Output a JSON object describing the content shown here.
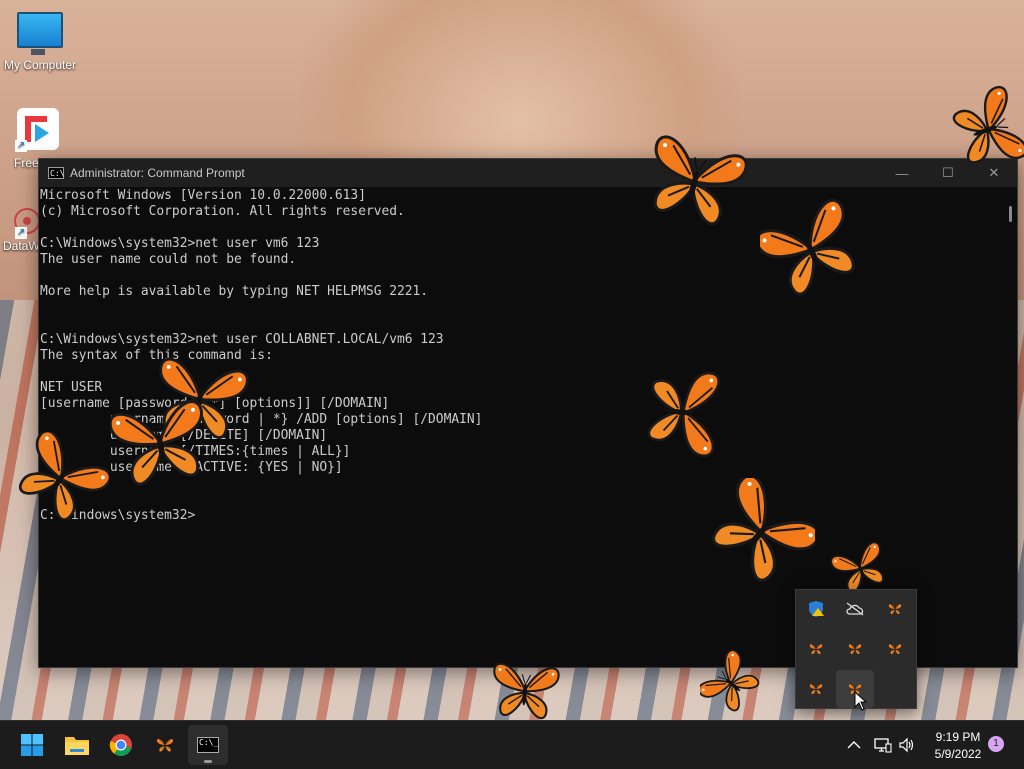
{
  "desktop": {
    "icons": [
      {
        "label": "My Computer",
        "icon": "monitor-icon"
      },
      {
        "label": "Free",
        "icon": "app-icon"
      },
      {
        "label": "DataW",
        "icon": "app-icon"
      }
    ]
  },
  "window": {
    "title": "Administrator: Command Prompt",
    "icon": "cmd-icon",
    "controls": {
      "minimize": "—",
      "maximize": "☐",
      "close": "✕"
    }
  },
  "console": {
    "lines": [
      "Microsoft Windows [Version 10.0.22000.613]",
      "(c) Microsoft Corporation. All rights reserved.",
      "",
      "C:\\Windows\\system32>net user vm6 123",
      "The user name could not be found.",
      "",
      "More help is available by typing NET HELPMSG 2221.",
      "",
      "",
      "C:\\Windows\\system32>net user COLLABNET.LOCAL/vm6 123",
      "The syntax of this command is:",
      "",
      "NET USER",
      "[username [password | *] [options]] [/DOMAIN]",
      "         username {password | *} /ADD [options] [/DOMAIN]",
      "         username [/DELETE] [/DOMAIN]",
      "         username [/TIMES:{times | ALL}]",
      "         username [/ACTIVE: {YES | NO}]",
      "",
      "",
      "C:\\Windows\\system32>"
    ]
  },
  "tray_flyout": {
    "items": [
      {
        "icon": "windows-security-warning-icon"
      },
      {
        "icon": "onedrive-offline-icon"
      },
      {
        "icon": "butterfly-icon"
      },
      {
        "icon": "butterfly-icon"
      },
      {
        "icon": "butterfly-icon"
      },
      {
        "icon": "butterfly-icon"
      },
      {
        "icon": "butterfly-icon"
      },
      {
        "icon": "butterfly-icon"
      }
    ]
  },
  "taskbar": {
    "apps": [
      {
        "name": "Start",
        "icon": "windows-start-icon"
      },
      {
        "name": "File Explorer",
        "icon": "folder-icon"
      },
      {
        "name": "Google Chrome",
        "icon": "chrome-icon"
      },
      {
        "name": "Butterflies",
        "icon": "butterfly-icon"
      },
      {
        "name": "Command Prompt",
        "icon": "cmd-icon",
        "active": true
      }
    ],
    "clock": {
      "time": "9:19 PM",
      "date": "5/9/2022"
    },
    "notification_count": "1"
  },
  "colors": {
    "accent": "#0078d4",
    "butterfly": "#f07a1a",
    "console_bg": "#0c0c0c",
    "console_text": "#cccccc"
  }
}
